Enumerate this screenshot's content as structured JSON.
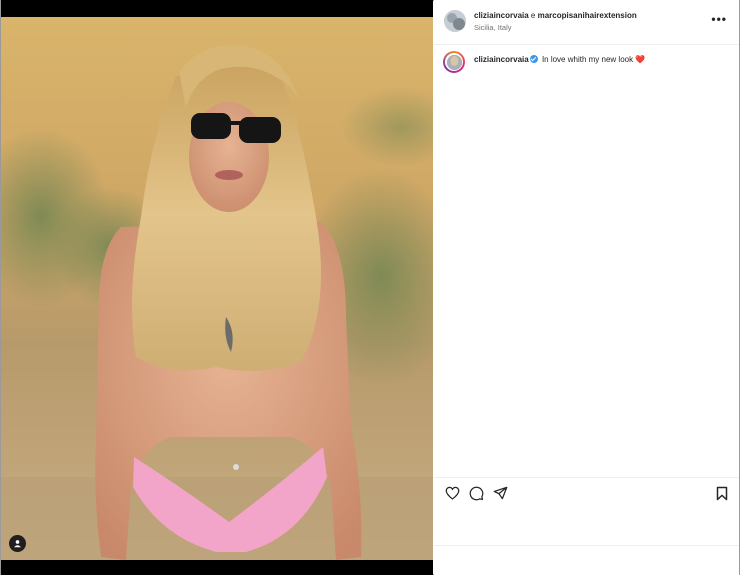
{
  "post": {
    "header": {
      "username_1": "cliziaincorvaia",
      "join_word": " e ",
      "username_2": "marcopisanihairextension",
      "location": "Sicilia, Italy",
      "more_icon": "more-horizontal-icon"
    },
    "caption": {
      "username": "cliziaincorvaia",
      "verified_icon": "verified-badge-icon",
      "text": "In love whith my new look",
      "emoji": "❤️"
    },
    "actions": {
      "like_icon": "heart-icon",
      "comment_icon": "comment-icon",
      "share_icon": "share-icon",
      "save_icon": "bookmark-icon"
    },
    "media": {
      "tag_icon": "user-tag-icon"
    },
    "colors": {
      "verified": "#3897f0",
      "text": "#262626",
      "secondary_text": "#737373",
      "story_ring": [
        "#f58529",
        "#dd2a7b",
        "#8134af"
      ]
    }
  }
}
